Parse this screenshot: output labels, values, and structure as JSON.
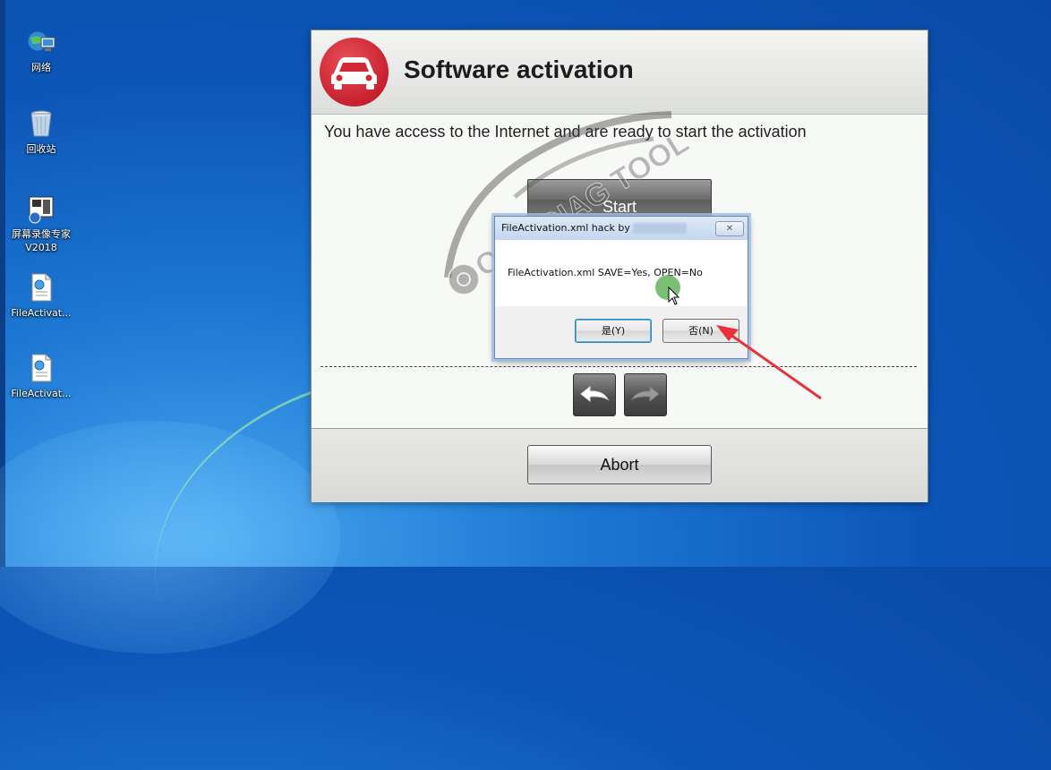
{
  "desktop": {
    "icons": [
      {
        "label": "网络"
      },
      {
        "label": "回收站"
      },
      {
        "label": "屏幕录像专家V2018"
      },
      {
        "label": "FileActivat..."
      },
      {
        "label": "FileActivat..."
      }
    ]
  },
  "window": {
    "title": "Software activation",
    "message": "You have access to the Internet and are ready to start the activation",
    "start_label": "Start",
    "abort_label": "Abort"
  },
  "watermark": {
    "text": "OBD DIAG TOOL"
  },
  "dialog": {
    "title": "FileActivation.xml hack by",
    "close_label": "✕",
    "message": "FileActivation.xml SAVE=Yes, OPEN=No",
    "yes_label": "是(Y)",
    "no_label": "否(N)"
  },
  "colors": {
    "accent_red": "#d42a34",
    "annotation_arrow": "#e8323a"
  }
}
